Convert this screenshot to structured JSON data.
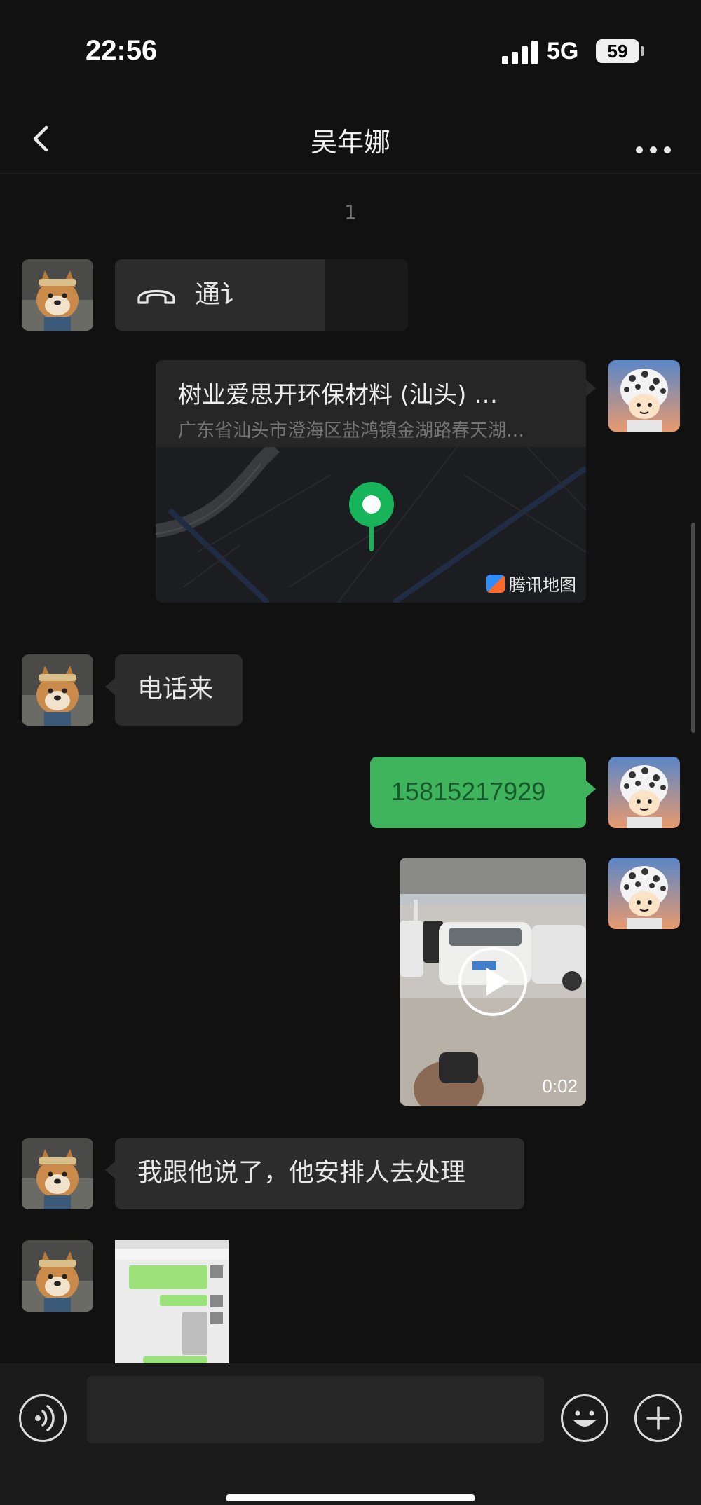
{
  "status_bar": {
    "time": "22:56",
    "network": "5G",
    "battery": "59"
  },
  "header": {
    "title": "吴年娜",
    "back_icon": "chevron-left-icon",
    "more_icon": "ellipsis-icon"
  },
  "chat": {
    "time_separator": "1",
    "messages": [
      {
        "type": "call",
        "side": "left",
        "text": "通讠",
        "icon": "phone-hangup-icon"
      },
      {
        "type": "location",
        "side": "right",
        "title": "树业爱思开环保材料 (汕头) …",
        "address": "广东省汕头市澄海区盐鸿镇金湖路春天湖…",
        "map_brand": "腾讯地图"
      },
      {
        "type": "text",
        "side": "left",
        "text": "电话来"
      },
      {
        "type": "text",
        "side": "right",
        "text": "15815217929"
      },
      {
        "type": "video",
        "side": "right",
        "duration": "0:02"
      },
      {
        "type": "text",
        "side": "left",
        "text": "我跟他说了，他安排人去处理"
      },
      {
        "type": "image",
        "side": "left"
      }
    ]
  },
  "input_bar": {
    "voice_icon": "voice-icon",
    "emoji_icon": "emoji-icon",
    "plus_icon": "plus-icon",
    "input_value": "",
    "input_placeholder": ""
  },
  "colors": {
    "background": "#111111",
    "bubble_dark": "#2c2c2c",
    "bubble_green": "#3fb45d",
    "map_pin": "#17b45a"
  }
}
